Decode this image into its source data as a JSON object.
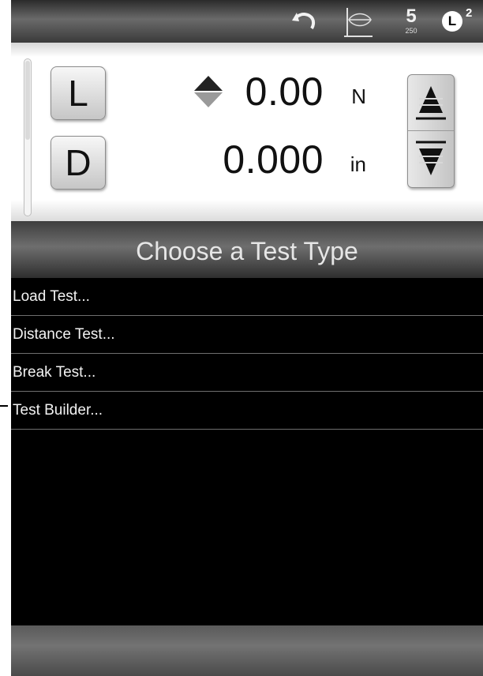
{
  "topbar": {
    "icons": [
      "undo-icon",
      "view-icon",
      "speed-setting-icon",
      "load-channel-icon"
    ],
    "speed_value": "5",
    "speed_sub": "250",
    "channel_letter": "L",
    "channel_number": "2"
  },
  "readout": {
    "load_button": "L",
    "distance_button": "D",
    "load_value": "0.00",
    "load_unit": "N",
    "distance_value": "0.000",
    "distance_unit": "in"
  },
  "menu": {
    "title": "Choose a Test Type",
    "items": [
      {
        "label": "Load Test..."
      },
      {
        "label": "Distance Test..."
      },
      {
        "label": "Break Test..."
      },
      {
        "label": "Test Builder..."
      }
    ]
  },
  "colors": {
    "background": "#000000",
    "readout_bg": "#ffffff",
    "menu_text": "#f2f2f2",
    "divider": "#6f6f6f"
  }
}
